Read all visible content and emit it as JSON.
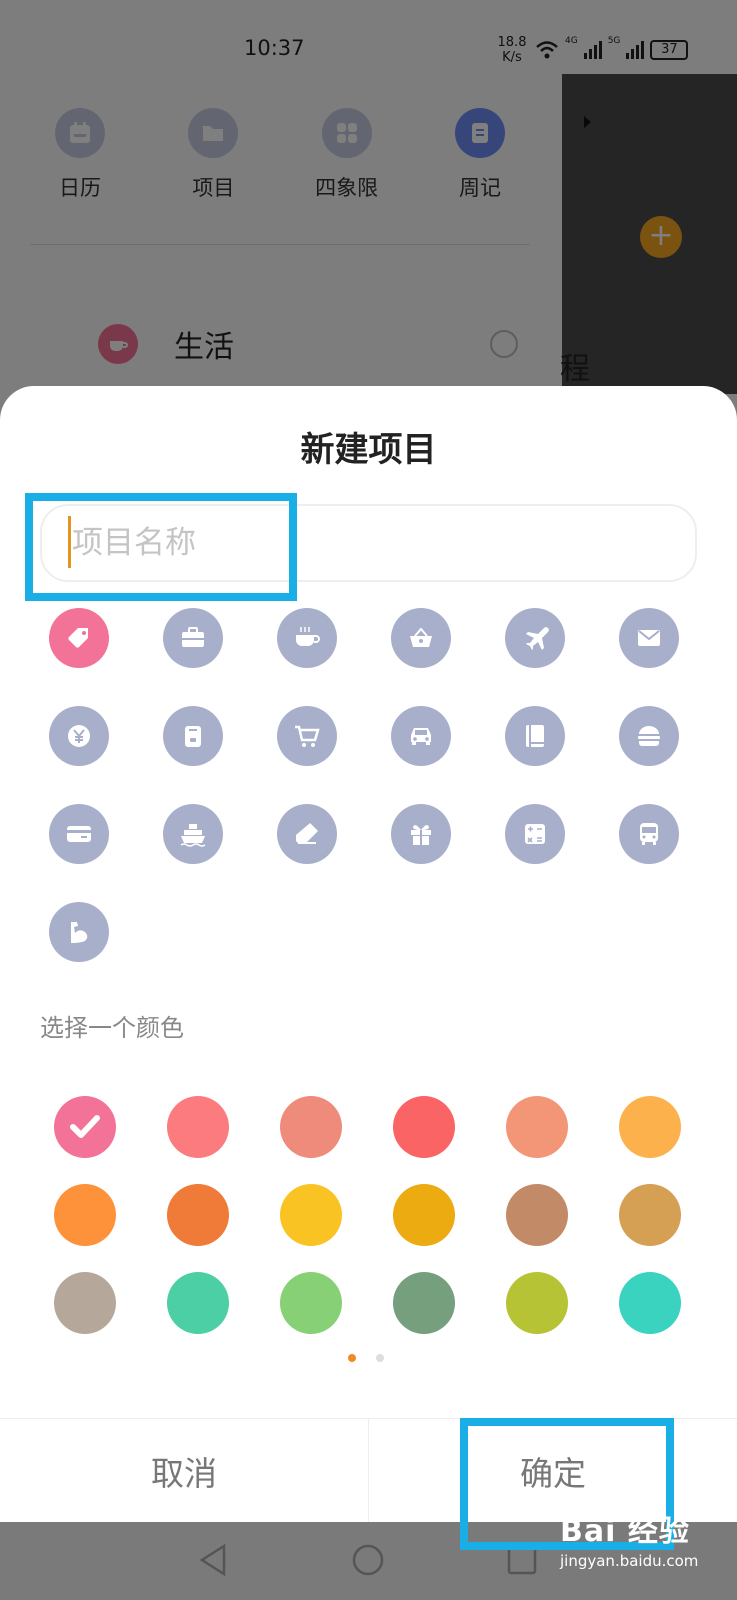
{
  "status_bar": {
    "time": "10:37",
    "net_speed_value": "18.8",
    "net_speed_unit": "K/s",
    "signal_1": "4G",
    "signal_2": "5G",
    "battery": "37"
  },
  "top_nav": {
    "items": [
      {
        "label": "日历",
        "icon": "calendar-icon"
      },
      {
        "label": "项目",
        "icon": "folder-icon"
      },
      {
        "label": "四象限",
        "icon": "grid-icon"
      },
      {
        "label": "周记",
        "icon": "note-icon"
      }
    ]
  },
  "background_list": {
    "project_label": "生活",
    "side_char": "程"
  },
  "dialog": {
    "title": "新建项目",
    "name_placeholder": "项目名称",
    "name_value": "",
    "icons": [
      {
        "name": "tag-icon",
        "selected": true
      },
      {
        "name": "briefcase-icon",
        "selected": false
      },
      {
        "name": "coffee-cup-icon",
        "selected": false
      },
      {
        "name": "shopping-basket-icon",
        "selected": false
      },
      {
        "name": "airplane-icon",
        "selected": false
      },
      {
        "name": "envelope-icon",
        "selected": false
      },
      {
        "name": "yen-icon",
        "selected": false
      },
      {
        "name": "luggage-icon",
        "selected": false
      },
      {
        "name": "shopping-cart-icon",
        "selected": false
      },
      {
        "name": "car-icon",
        "selected": false
      },
      {
        "name": "book-icon",
        "selected": false
      },
      {
        "name": "burger-icon",
        "selected": false
      },
      {
        "name": "credit-card-icon",
        "selected": false
      },
      {
        "name": "ship-icon",
        "selected": false
      },
      {
        "name": "eraser-icon",
        "selected": false
      },
      {
        "name": "gift-icon",
        "selected": false
      },
      {
        "name": "calculator-icon",
        "selected": false
      },
      {
        "name": "bus-icon",
        "selected": false
      },
      {
        "name": "muscle-icon",
        "selected": false
      }
    ],
    "color_label": "选择一个颜色",
    "colors": [
      "#f27397",
      "#fb7b7f",
      "#ee8b7b",
      "#fb6464",
      "#f39677",
      "#fdb14c",
      "#fd923b",
      "#f07a37",
      "#f9c423",
      "#edab12",
      "#c38a67",
      "#d5a054",
      "#b5a89b",
      "#4ccfa4",
      "#87d076",
      "#76a07d",
      "#b5c334",
      "#39d3c0"
    ],
    "selected_color_index": 0,
    "pages": 2,
    "current_page": 0,
    "cancel_label": "取消",
    "confirm_label": "确定"
  },
  "watermark": {
    "main": "Bai 经验",
    "sub": "jingyan.baidu.com"
  }
}
